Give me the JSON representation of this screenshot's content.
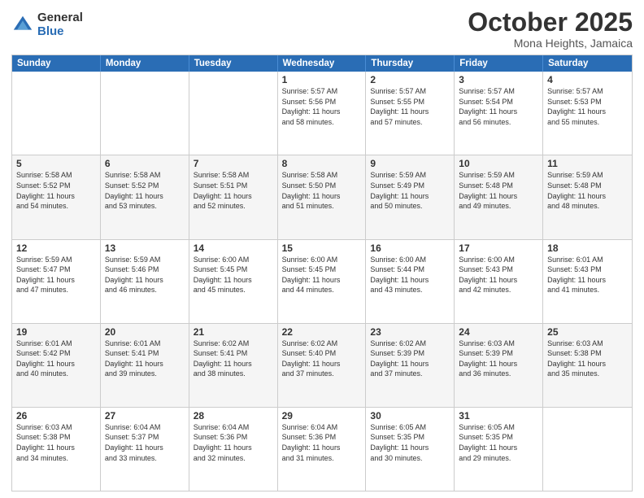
{
  "header": {
    "logo": {
      "general": "General",
      "blue": "Blue"
    },
    "title": "October 2025",
    "location": "Mona Heights, Jamaica"
  },
  "weekdays": [
    "Sunday",
    "Monday",
    "Tuesday",
    "Wednesday",
    "Thursday",
    "Friday",
    "Saturday"
  ],
  "weeks": [
    [
      {
        "day": "",
        "info": "",
        "shaded": false,
        "empty": true
      },
      {
        "day": "",
        "info": "",
        "shaded": false,
        "empty": true
      },
      {
        "day": "",
        "info": "",
        "shaded": false,
        "empty": true
      },
      {
        "day": "1",
        "info": "Sunrise: 5:57 AM\nSunset: 5:56 PM\nDaylight: 11 hours\nand 58 minutes.",
        "shaded": false
      },
      {
        "day": "2",
        "info": "Sunrise: 5:57 AM\nSunset: 5:55 PM\nDaylight: 11 hours\nand 57 minutes.",
        "shaded": false
      },
      {
        "day": "3",
        "info": "Sunrise: 5:57 AM\nSunset: 5:54 PM\nDaylight: 11 hours\nand 56 minutes.",
        "shaded": false
      },
      {
        "day": "4",
        "info": "Sunrise: 5:57 AM\nSunset: 5:53 PM\nDaylight: 11 hours\nand 55 minutes.",
        "shaded": false
      }
    ],
    [
      {
        "day": "5",
        "info": "Sunrise: 5:58 AM\nSunset: 5:52 PM\nDaylight: 11 hours\nand 54 minutes.",
        "shaded": true
      },
      {
        "day": "6",
        "info": "Sunrise: 5:58 AM\nSunset: 5:52 PM\nDaylight: 11 hours\nand 53 minutes.",
        "shaded": true
      },
      {
        "day": "7",
        "info": "Sunrise: 5:58 AM\nSunset: 5:51 PM\nDaylight: 11 hours\nand 52 minutes.",
        "shaded": true
      },
      {
        "day": "8",
        "info": "Sunrise: 5:58 AM\nSunset: 5:50 PM\nDaylight: 11 hours\nand 51 minutes.",
        "shaded": true
      },
      {
        "day": "9",
        "info": "Sunrise: 5:59 AM\nSunset: 5:49 PM\nDaylight: 11 hours\nand 50 minutes.",
        "shaded": true
      },
      {
        "day": "10",
        "info": "Sunrise: 5:59 AM\nSunset: 5:48 PM\nDaylight: 11 hours\nand 49 minutes.",
        "shaded": true
      },
      {
        "day": "11",
        "info": "Sunrise: 5:59 AM\nSunset: 5:48 PM\nDaylight: 11 hours\nand 48 minutes.",
        "shaded": true
      }
    ],
    [
      {
        "day": "12",
        "info": "Sunrise: 5:59 AM\nSunset: 5:47 PM\nDaylight: 11 hours\nand 47 minutes.",
        "shaded": false
      },
      {
        "day": "13",
        "info": "Sunrise: 5:59 AM\nSunset: 5:46 PM\nDaylight: 11 hours\nand 46 minutes.",
        "shaded": false
      },
      {
        "day": "14",
        "info": "Sunrise: 6:00 AM\nSunset: 5:45 PM\nDaylight: 11 hours\nand 45 minutes.",
        "shaded": false
      },
      {
        "day": "15",
        "info": "Sunrise: 6:00 AM\nSunset: 5:45 PM\nDaylight: 11 hours\nand 44 minutes.",
        "shaded": false
      },
      {
        "day": "16",
        "info": "Sunrise: 6:00 AM\nSunset: 5:44 PM\nDaylight: 11 hours\nand 43 minutes.",
        "shaded": false
      },
      {
        "day": "17",
        "info": "Sunrise: 6:00 AM\nSunset: 5:43 PM\nDaylight: 11 hours\nand 42 minutes.",
        "shaded": false
      },
      {
        "day": "18",
        "info": "Sunrise: 6:01 AM\nSunset: 5:43 PM\nDaylight: 11 hours\nand 41 minutes.",
        "shaded": false
      }
    ],
    [
      {
        "day": "19",
        "info": "Sunrise: 6:01 AM\nSunset: 5:42 PM\nDaylight: 11 hours\nand 40 minutes.",
        "shaded": true
      },
      {
        "day": "20",
        "info": "Sunrise: 6:01 AM\nSunset: 5:41 PM\nDaylight: 11 hours\nand 39 minutes.",
        "shaded": true
      },
      {
        "day": "21",
        "info": "Sunrise: 6:02 AM\nSunset: 5:41 PM\nDaylight: 11 hours\nand 38 minutes.",
        "shaded": true
      },
      {
        "day": "22",
        "info": "Sunrise: 6:02 AM\nSunset: 5:40 PM\nDaylight: 11 hours\nand 37 minutes.",
        "shaded": true
      },
      {
        "day": "23",
        "info": "Sunrise: 6:02 AM\nSunset: 5:39 PM\nDaylight: 11 hours\nand 37 minutes.",
        "shaded": true
      },
      {
        "day": "24",
        "info": "Sunrise: 6:03 AM\nSunset: 5:39 PM\nDaylight: 11 hours\nand 36 minutes.",
        "shaded": true
      },
      {
        "day": "25",
        "info": "Sunrise: 6:03 AM\nSunset: 5:38 PM\nDaylight: 11 hours\nand 35 minutes.",
        "shaded": true
      }
    ],
    [
      {
        "day": "26",
        "info": "Sunrise: 6:03 AM\nSunset: 5:38 PM\nDaylight: 11 hours\nand 34 minutes.",
        "shaded": false
      },
      {
        "day": "27",
        "info": "Sunrise: 6:04 AM\nSunset: 5:37 PM\nDaylight: 11 hours\nand 33 minutes.",
        "shaded": false
      },
      {
        "day": "28",
        "info": "Sunrise: 6:04 AM\nSunset: 5:36 PM\nDaylight: 11 hours\nand 32 minutes.",
        "shaded": false
      },
      {
        "day": "29",
        "info": "Sunrise: 6:04 AM\nSunset: 5:36 PM\nDaylight: 11 hours\nand 31 minutes.",
        "shaded": false
      },
      {
        "day": "30",
        "info": "Sunrise: 6:05 AM\nSunset: 5:35 PM\nDaylight: 11 hours\nand 30 minutes.",
        "shaded": false
      },
      {
        "day": "31",
        "info": "Sunrise: 6:05 AM\nSunset: 5:35 PM\nDaylight: 11 hours\nand 29 minutes.",
        "shaded": false
      },
      {
        "day": "",
        "info": "",
        "shaded": false,
        "empty": true
      }
    ]
  ]
}
